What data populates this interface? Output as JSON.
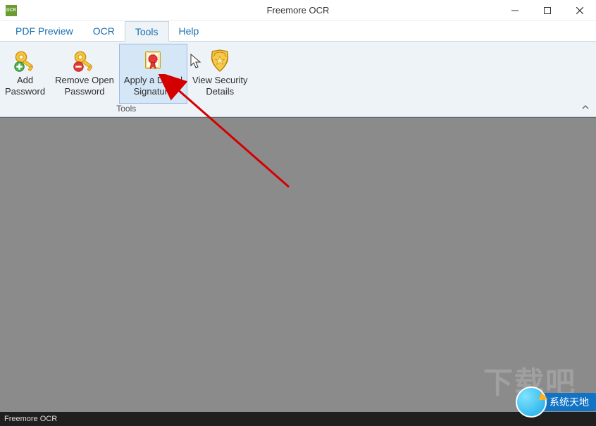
{
  "window": {
    "title": "Freemore OCR",
    "app_icon_text": "OCR"
  },
  "menus": {
    "items": [
      "PDF Preview",
      "OCR",
      "Tools",
      "Help"
    ],
    "active_index": 2
  },
  "ribbon": {
    "group_label": "Tools",
    "buttons": [
      {
        "label": "Add\nPassword",
        "icon": "key-add"
      },
      {
        "label": "Remove Open\nPassword",
        "icon": "key-remove"
      },
      {
        "label": "Apply a Digital\nSignature",
        "icon": "seal",
        "hover": true
      },
      {
        "label": "View Security\nDetails",
        "icon": "shield"
      }
    ]
  },
  "status": {
    "text": "Freemore OCR"
  },
  "watermark": {
    "text": "下载吧"
  },
  "badge": {
    "text": "系统天地"
  }
}
